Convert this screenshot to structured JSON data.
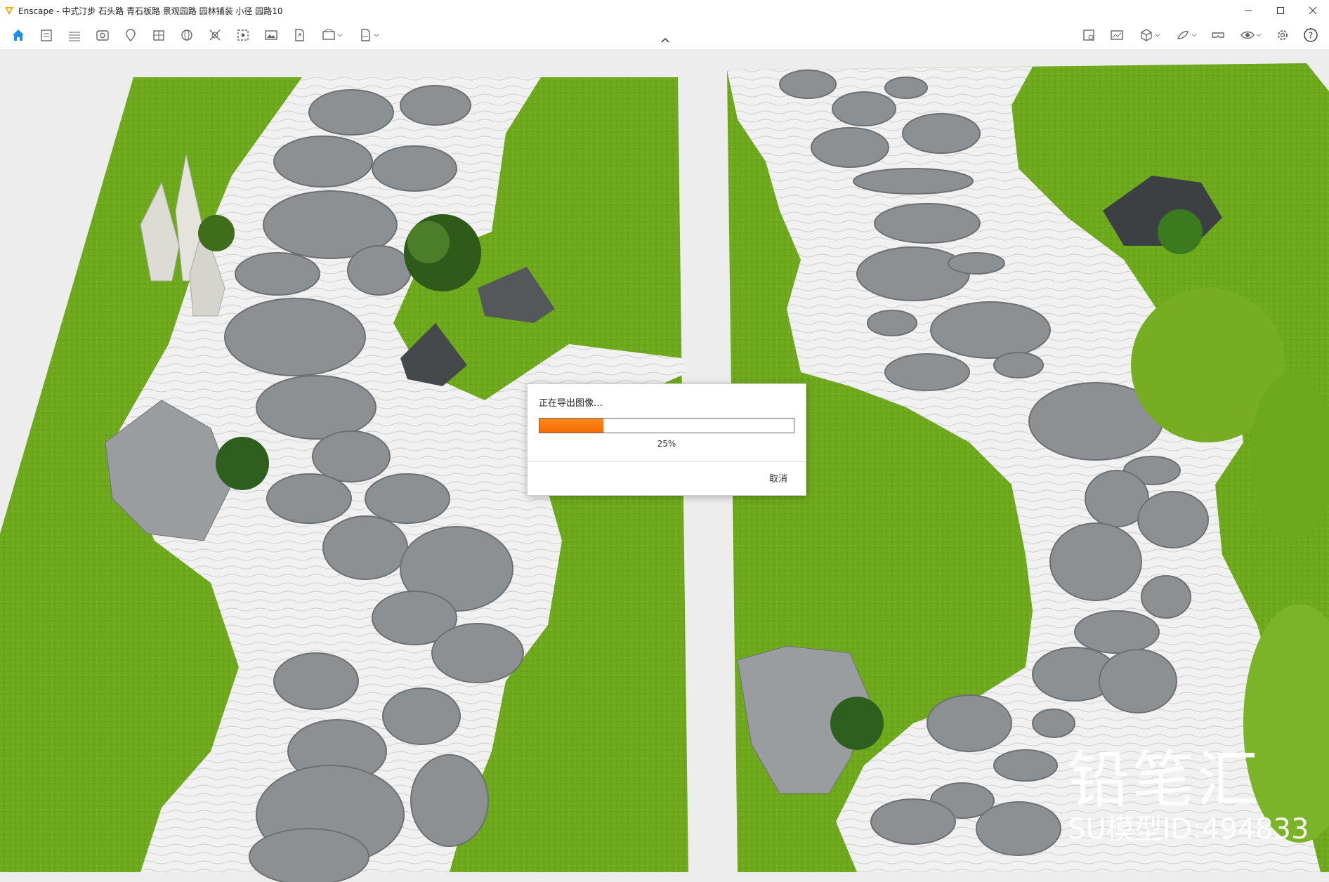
{
  "window": {
    "app_name": "Enscape",
    "title": "Enscape - 中式汀步 石头路 青石板路 景观园路 园林铺装 小径 园路10",
    "accent": "#f2a900"
  },
  "toolbar": {
    "left_icons": [
      "home-icon",
      "asset-library-icon",
      "bim-icon",
      "view-icon",
      "map-pin-icon",
      "batch-render-icon",
      "panorama-icon",
      "video-editor-icon",
      "screenshot-icon",
      "image-icon",
      "export-icon",
      "standalone-icon",
      "exe-icon"
    ],
    "right_icons": [
      "material-editor-icon",
      "image-view-icon",
      "cube-icon",
      "sun-icon",
      "vr-headset-icon",
      "visual-settings-icon",
      "settings-icon",
      "help-icon"
    ]
  },
  "dialog": {
    "message": "正在导出图像…",
    "progress": 0.25,
    "progress_label": "25%",
    "cancel_label": "取消"
  },
  "watermark": {
    "brand": "铅笔汇",
    "model_id": "SU模型ID:494833"
  },
  "colors": {
    "grass": "#6ea81d",
    "gravel": "#f1f1f1",
    "stone": "#8d9092",
    "progress": "#f47a0a"
  }
}
